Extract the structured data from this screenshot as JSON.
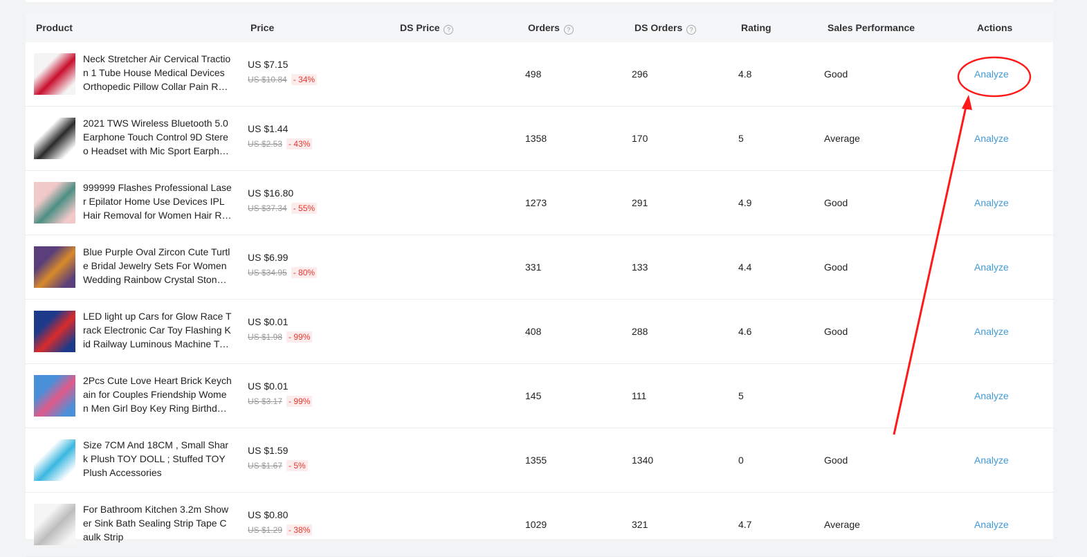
{
  "table": {
    "headers": {
      "product": "Product",
      "price": "Price",
      "ds_price": "DS Price",
      "orders": "Orders",
      "ds_orders": "DS Orders",
      "rating": "Rating",
      "sales_performance": "Sales Performance",
      "actions": "Actions"
    },
    "help_glyph": "?",
    "rows": [
      {
        "title": "Neck Stretcher Air Cervical Traction 1 Tube House Medical Devices Orthopedic Pillow Collar Pain Relief Blue",
        "price": "US $7.15",
        "orig_price": "US $10.84",
        "discount": "- 34%",
        "orders": "498",
        "ds_orders": "296",
        "rating": "4.8",
        "performance": "Good",
        "action": "Analyze",
        "thumb_colors": [
          "#c8102e",
          "#f4f4f4"
        ]
      },
      {
        "title": "2021 TWS Wireless Bluetooth 5.0 Earphone Touch Control 9D Stereo Headset with Mic Sport Earphones Waterproof",
        "price": "US $1.44",
        "orig_price": "US $2.53",
        "discount": "- 43%",
        "orders": "1358",
        "ds_orders": "170",
        "rating": "5",
        "performance": "Average",
        "action": "Analyze",
        "thumb_colors": [
          "#2a2a2a",
          "#ffffff"
        ]
      },
      {
        "title": "999999 Flashes Professional Laser Epilator Home Use Devices IPL Hair Removal for Women Hair Remover",
        "price": "US $16.80",
        "orig_price": "US $37.34",
        "discount": "- 55%",
        "orders": "1273",
        "ds_orders": "291",
        "rating": "4.9",
        "performance": "Good",
        "action": "Analyze",
        "thumb_colors": [
          "#4d8f84",
          "#f1c9c9"
        ]
      },
      {
        "title": "Blue Purple Oval Zircon Cute Turtle Bridal Jewelry Sets For Women Wedding Rainbow Crystal Stone Necklace",
        "price": "US $6.99",
        "orig_price": "US $34.95",
        "discount": "- 80%",
        "orders": "331",
        "ds_orders": "133",
        "rating": "4.4",
        "performance": "Good",
        "action": "Analyze",
        "thumb_colors": [
          "#d88a2a",
          "#5b3f7a"
        ]
      },
      {
        "title": "LED light up Cars for Glow Race Track Electronic Car Toy Flashing Kid Railway Luminous Machine Track Car",
        "price": "US $0.01",
        "orig_price": "US $1.98",
        "discount": "- 99%",
        "orders": "408",
        "ds_orders": "288",
        "rating": "4.6",
        "performance": "Good",
        "action": "Analyze",
        "thumb_colors": [
          "#d92b2b",
          "#1d3a8a"
        ]
      },
      {
        "title": "2Pcs Cute Love Heart Brick Keychain for Couples Friendship Women Men Girl Boy Key Ring Birthday Jewelry",
        "price": "US $0.01",
        "orig_price": "US $3.17",
        "discount": "- 99%",
        "orders": "145",
        "ds_orders": "111",
        "rating": "5",
        "performance": "",
        "action": "Analyze",
        "thumb_colors": [
          "#e05a8a",
          "#4a90d9"
        ]
      },
      {
        "title": "Size 7CM And 18CM , Small Shark Plush TOY DOLL ; Stuffed TOY Plush Accessories",
        "price": "US $1.59",
        "orig_price": "US $1.67",
        "discount": "- 5%",
        "orders": "1355",
        "ds_orders": "1340",
        "rating": "0",
        "performance": "Good",
        "action": "Analyze",
        "thumb_colors": [
          "#3bb7e0",
          "#ffffff"
        ]
      },
      {
        "title": "For Bathroom Kitchen 3.2m Shower Sink Bath Sealing Strip Tape Caulk Strip",
        "price": "US $0.80",
        "orig_price": "US $1.29",
        "discount": "- 38%",
        "orders": "1029",
        "ds_orders": "321",
        "rating": "4.7",
        "performance": "Average",
        "action": "Analyze",
        "thumb_colors": [
          "#bdbdbd",
          "#f5f5f5"
        ]
      }
    ]
  },
  "annotation": {
    "color": "#ff1a1a"
  }
}
